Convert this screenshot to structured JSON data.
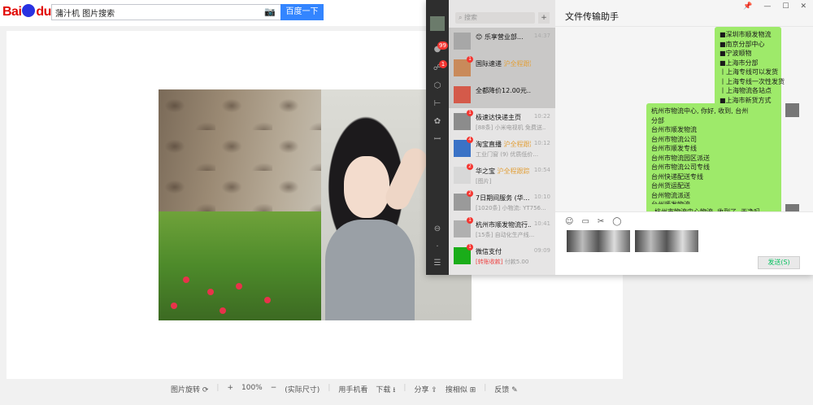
{
  "baidu": {
    "logo": "Bai",
    "logo_suffix": "du",
    "logo_pic": "图片",
    "search_value": "蒲汁机 图片搜索",
    "camera_icon": "camera-icon",
    "search_button": "百度一下"
  },
  "viewer": {
    "toolbar": {
      "rotate": "图片旋转 ⟳",
      "zoom_in": "+",
      "zoom": "100%",
      "zoom_out": "−",
      "fullsize": "(实际尺寸)",
      "phone": "用手机看",
      "download": "下载 ⭳",
      "share": "分享 ⇪",
      "search": "搜相似 ⊞",
      "feedback": "反馈 ✎"
    }
  },
  "wechat": {
    "search_placeholder": "搜索",
    "plus": "+",
    "sidebar": {
      "badge_chat": "99",
      "badge_contacts": "1"
    },
    "conversations": [
      {
        "name": "😊 乐享营业部...",
        "time": "14:37",
        "msg": "",
        "badge": ""
      },
      {
        "name": "国际速递",
        "name_hl": " 沪全程跟踪单号...",
        "time": "",
        "msg": "",
        "badge": "1"
      },
      {
        "name": "全都降价12.00元...",
        "name_hl": "",
        "time": "",
        "msg": "",
        "badge": ""
      },
      {
        "name": "极速达快递主页",
        "time": "10:22",
        "msg": "[88条] 小米电视机 免费送...",
        "badge": "1"
      },
      {
        "name": "淘宝直播",
        "name_hl": " 沪全程跟踪...",
        "time": "10:12",
        "msg": "工业门窗 (9) 优质低价...",
        "badge": "4"
      },
      {
        "name": "华之宝",
        "name_hl": " 沪全程跟踪",
        "time": "10:54",
        "msg": "[图片]",
        "badge": "2"
      },
      {
        "name": "7日期间服务 (华...",
        "time": "10:10",
        "msg": "[1020条] 小物流: YT756...",
        "badge": "2"
      },
      {
        "name": "杭州市顺发物流行...",
        "time": "10:41",
        "msg": "[15条] 自动化生产线...",
        "badge": "1"
      },
      {
        "name": "微信支付",
        "time": "09:09",
        "msg_red": "[转账收款]",
        "msg": " 付款5.00",
        "badge": "1"
      }
    ],
    "chat_title": "文件传输助手",
    "win_pin": "📌",
    "win_min": "—",
    "win_max": "☐",
    "win_close": "✕",
    "bubble1": [
      "■深圳市顺发物流",
      "■南京分部中心",
      "■宁波顺物",
      "■上海市分部",
      "丨上海专线可以发货",
      "丨上海专线一次性发货",
      "丨上海物流各站点",
      "■上海市新货方式"
    ],
    "bubble2": [
      "杭州市物流中心, 你好, 收到, 台州",
      "分部",
      "台州市顺发物流",
      "台州市物流公司",
      "台州市顺发专线",
      "台州市物流园区派送",
      "台州市物流公司专线",
      "台州快递配送专线",
      "台州货运配送",
      "台州物流派送",
      "台州顺发物流",
      "台州物流配送公司"
    ],
    "bubble3": [
      "杭州市物流中心物流, 收到了, 干净吗..."
    ],
    "tools": [
      "☺",
      "▭",
      "✂",
      "◯"
    ],
    "send_button": "发送(S)"
  }
}
